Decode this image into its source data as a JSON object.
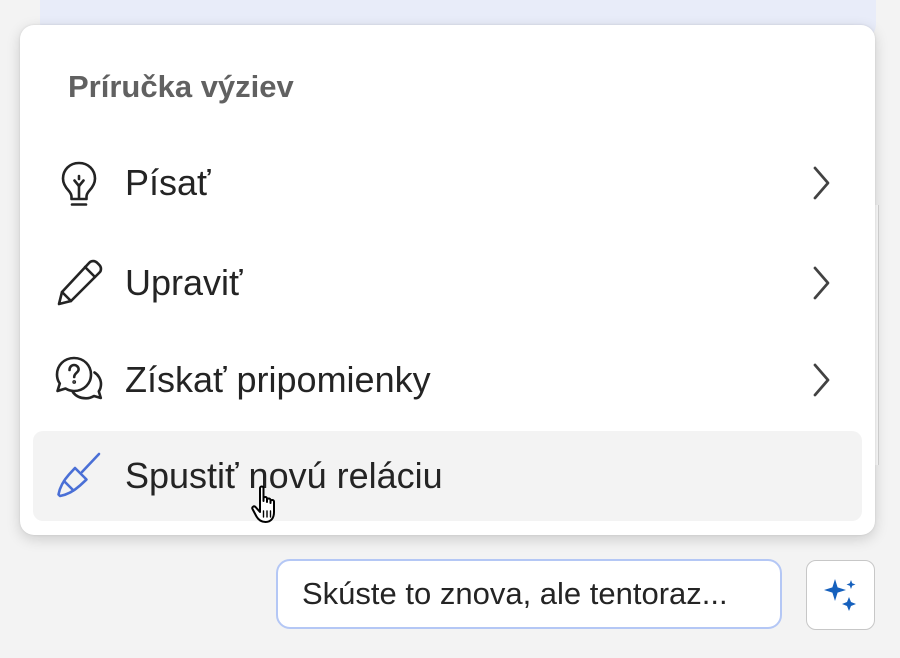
{
  "menu": {
    "heading": "Príručka výziev",
    "items": [
      {
        "label": "Písať",
        "icon": "lightbulb-icon",
        "has_submenu": true
      },
      {
        "label": "Upraviť",
        "icon": "pencil-icon",
        "has_submenu": true
      },
      {
        "label": "Získať pripomienky",
        "icon": "chat-question-icon",
        "has_submenu": true
      },
      {
        "label": "Spustiť novú reláciu",
        "icon": "broom-icon",
        "has_submenu": false,
        "hovered": true
      }
    ]
  },
  "suggestion": {
    "label": "Skúste to znova, ale tentoraz..."
  },
  "sparkle_button": {
    "icon": "sparkle-icon"
  },
  "colors": {
    "accent_blue": "#4a6fd6",
    "sparkle_blue": "#1560bd",
    "chip_border": "#b4c7f5",
    "hover_bg": "#f3f3f3",
    "heading_gray": "#616161"
  }
}
